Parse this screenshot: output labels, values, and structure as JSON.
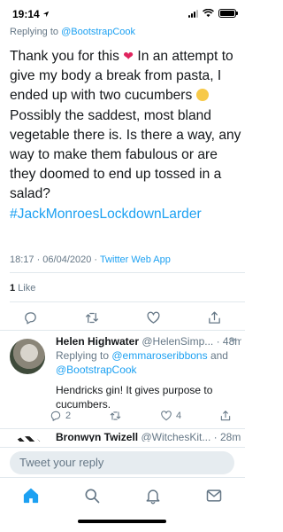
{
  "status_bar": {
    "time": "19:14"
  },
  "tweet": {
    "replying_prefix": "Replying to ",
    "replying_handle": "@BootstrapCook",
    "text_part1": "Thank you for this",
    "text_part2": "In an attempt to give my body a break from pasta, I ended up with two cucumbers",
    "text_part3": "Possibly the saddest, most bland vegetable there is. Is there a way, any way to make them fabulous or are they doomed to end up tossed in a salad?",
    "hashtag": "#JackMonroesLockdownLarder",
    "timestamp": "18:17 · 06/04/2020 · ",
    "source": "Twitter Web App",
    "like_count": "1",
    "like_label": " Like"
  },
  "reply": {
    "name": "Helen Highwater",
    "handle_time": "@HelenSimp... · 48m",
    "replying_prefix": "Replying to ",
    "replying_handle1": "@emmaroseribbons",
    "replying_and": " and",
    "replying_handle2": "@BootstrapCook",
    "text": "Hendricks gin! It gives purpose to cucumbers.",
    "reply_count": "2",
    "like_count": "4"
  },
  "next_reply": {
    "name": "Bronwyn Twizell",
    "handle_time": "@WitchesKit... · 28m"
  },
  "compose": {
    "placeholder": "Tweet your reply"
  },
  "icons": {
    "main_actions": [
      "reply-icon",
      "retweet-icon",
      "like-icon",
      "share-icon"
    ],
    "tabs": [
      "home-icon",
      "search-icon",
      "notifications-icon",
      "messages-icon"
    ]
  },
  "colors": {
    "accent": "#1da1f2",
    "heart": "#e0245e",
    "muted": "#657786",
    "text": "#14171a"
  }
}
